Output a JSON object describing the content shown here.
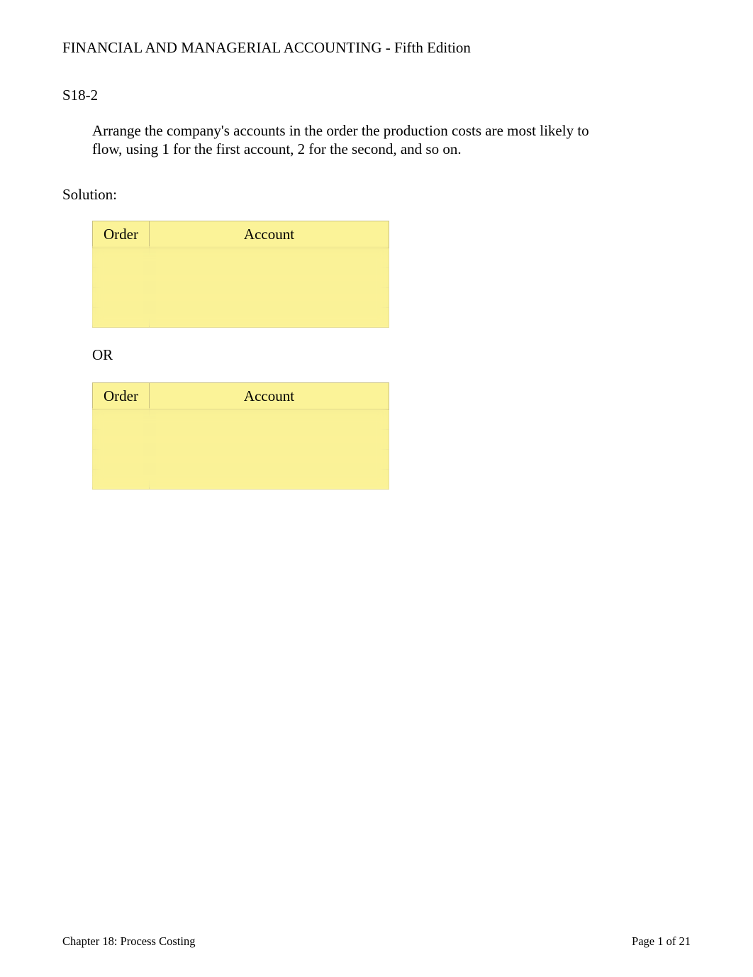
{
  "header": {
    "title": "FINANCIAL AND MANAGERIAL ACCOUNTING - Fifth Edition"
  },
  "problem": {
    "number": "S18-2",
    "text": "Arrange the company's accounts in the order the production costs are most likely to flow, using 1 for the first account, 2 for the second, and so on."
  },
  "solution": {
    "label": "Solution:",
    "table1": {
      "headers": {
        "order": "Order",
        "account": "Account"
      },
      "rows": [
        {
          "order": "",
          "account": ""
        },
        {
          "order": "",
          "account": ""
        },
        {
          "order": "",
          "account": ""
        },
        {
          "order": "",
          "account": ""
        }
      ]
    },
    "or_label": "OR",
    "table2": {
      "headers": {
        "order": "Order",
        "account": "Account"
      },
      "rows": [
        {
          "order": "",
          "account": ""
        },
        {
          "order": "",
          "account": ""
        },
        {
          "order": "",
          "account": ""
        },
        {
          "order": "",
          "account": ""
        }
      ]
    }
  },
  "footer": {
    "left": "Chapter 18: Process Costing",
    "right": "Page 1 of 21"
  }
}
